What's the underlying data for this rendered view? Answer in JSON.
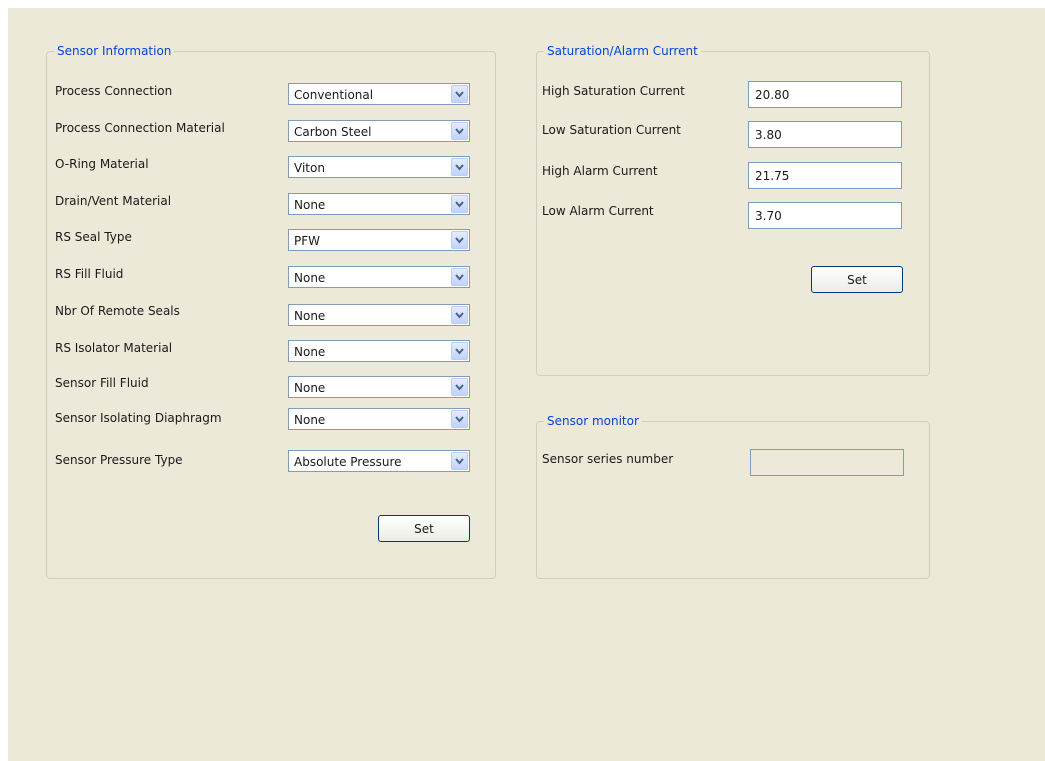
{
  "sensor_information": {
    "legend": "Sensor Information",
    "fields": [
      {
        "label": "Process Connection",
        "value": "Conventional"
      },
      {
        "label": "Process Connection Material",
        "value": "Carbon Steel"
      },
      {
        "label": "O-Ring Material",
        "value": "Viton"
      },
      {
        "label": "Drain/Vent Material",
        "value": "None"
      },
      {
        "label": "RS Seal Type",
        "value": "PFW"
      },
      {
        "label": "RS Fill Fluid",
        "value": "None"
      },
      {
        "label": "Nbr Of Remote Seals",
        "value": "None"
      },
      {
        "label": "RS Isolator Material",
        "value": "None"
      },
      {
        "label": "Sensor Fill Fluid",
        "value": "None"
      },
      {
        "label": "Sensor Isolating Diaphragm",
        "value": "None"
      },
      {
        "label": "Sensor Pressure Type",
        "value": "Absolute Pressure"
      }
    ],
    "set_label": "Set"
  },
  "saturation_alarm": {
    "legend": "Saturation/Alarm Current",
    "fields": [
      {
        "label": "High Saturation Current",
        "value": "20.80"
      },
      {
        "label": "Low Saturation Current",
        "value": "3.80"
      },
      {
        "label": "High Alarm Current",
        "value": "21.75"
      },
      {
        "label": "Low Alarm Current",
        "value": "3.70"
      }
    ],
    "set_label": "Set"
  },
  "sensor_monitor": {
    "legend": "Sensor monitor",
    "series_label": "Sensor series number",
    "series_value": ""
  },
  "icons": {
    "dropdown": "chevron-down-icon"
  },
  "colors": {
    "legend": "#0046d5",
    "panel": "#ece9d8",
    "field_border": "#7f9db9"
  }
}
